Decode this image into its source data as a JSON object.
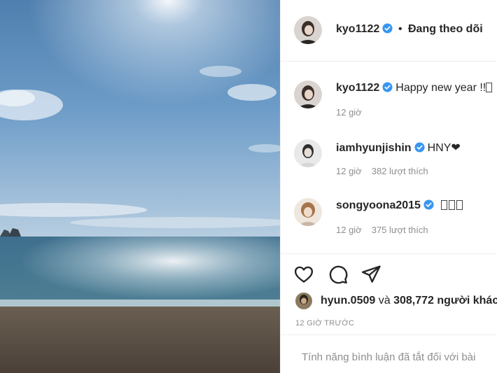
{
  "post": {
    "author": "kyo1122",
    "dot": "•",
    "following_label": "Đang theo dõi"
  },
  "comments": [
    {
      "username": "kyo1122",
      "text": "Happy new year !!",
      "time": "12 giờ",
      "likes": ""
    },
    {
      "username": "iamhyunjishin",
      "text": "HNY❤",
      "time": "12 giờ",
      "likes": "382 lượt thích"
    },
    {
      "username": "songyoona2015",
      "text": "",
      "time": "12 giờ",
      "likes": "375 lượt thích"
    }
  ],
  "icons": {
    "like": "heart-icon",
    "comment": "comment-icon",
    "share": "send-icon",
    "verified": "verified-badge-icon"
  },
  "liked_by": {
    "user": "hyun.0509",
    "and": "và",
    "others": "308,772 người khác"
  },
  "timestamp": "12 GIỜ TRƯỚC",
  "comments_disabled": "Tính năng bình luận đã tắt đối với bài",
  "colors": {
    "verified": "#3897f0",
    "text": "#262626",
    "muted": "#8e8e8e",
    "divider": "#efefef"
  }
}
